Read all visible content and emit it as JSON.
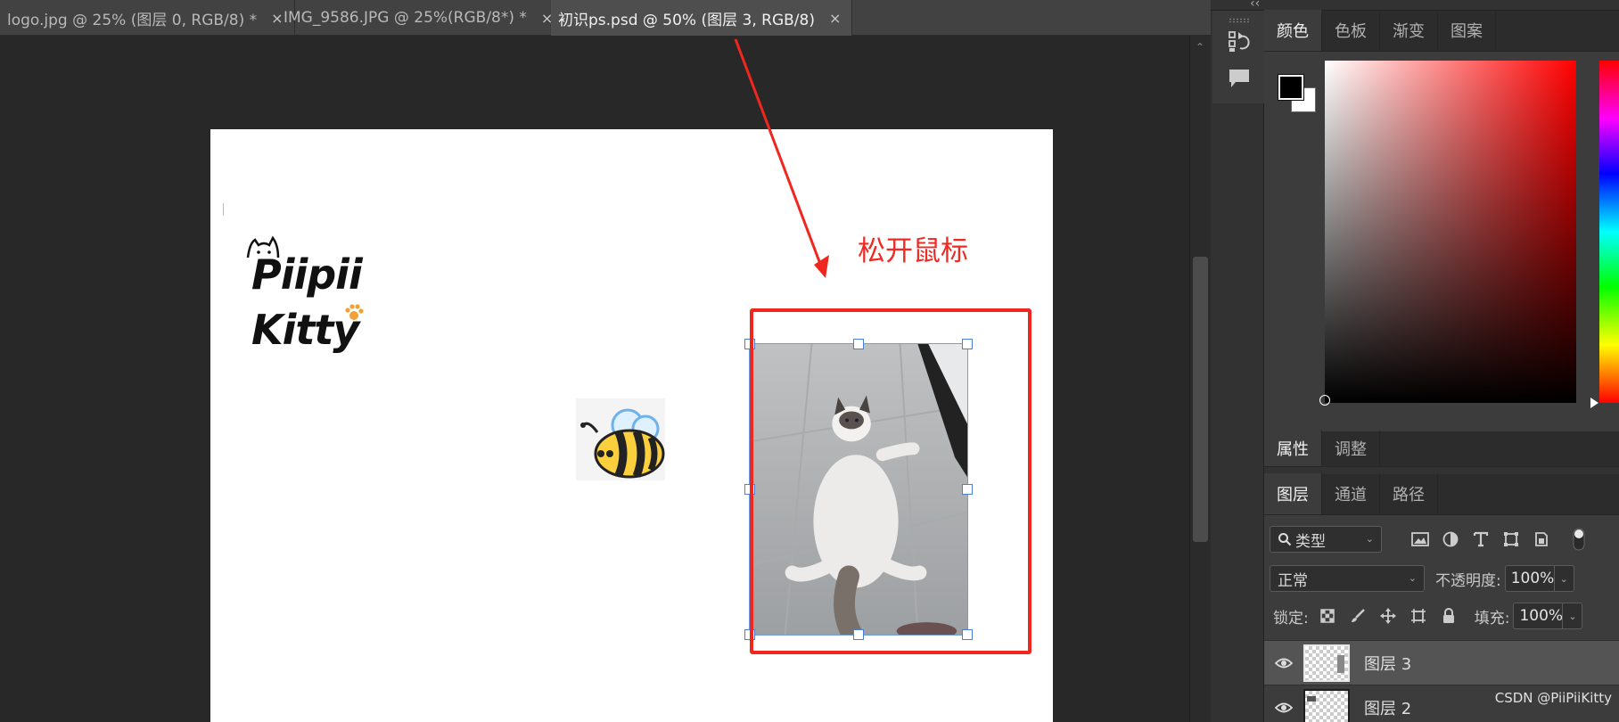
{
  "document_tabs": [
    {
      "title": "logo.jpg @ 25% (图层 0, RGB/8) *",
      "close": "×",
      "active": false
    },
    {
      "title": "IMG_9586.JPG @ 25%(RGB/8*) *",
      "close": "×",
      "active": false
    },
    {
      "title": "初识ps.psd @ 50% (图层 3, RGB/8)",
      "close": "×",
      "active": true
    }
  ],
  "canvas": {
    "logo_line1": "Piipii",
    "logo_line2": "Kitty",
    "annotation": "松开鼠标"
  },
  "dock": {
    "collapse_glyph": "‹‹"
  },
  "color_panel": {
    "tabs": [
      "颜色",
      "色板",
      "渐变",
      "图案"
    ],
    "active_tab": "颜色",
    "foreground_color": "#000000",
    "background_color": "#ffffff"
  },
  "properties_panel": {
    "tabs": [
      "属性",
      "调整"
    ],
    "active_tab": "属性"
  },
  "layers_panel": {
    "tabs": [
      "图层",
      "通道",
      "路径"
    ],
    "active_tab": "图层",
    "filter_label": "类型",
    "blend_mode": "正常",
    "opacity_label": "不透明度:",
    "opacity_value": "100%",
    "lock_label": "锁定:",
    "fill_label": "填充:",
    "fill_value": "100%",
    "layers": [
      {
        "name": "图层 3",
        "visible": true,
        "selected": true
      },
      {
        "name": "图层 2",
        "visible": true,
        "selected": false
      }
    ]
  },
  "watermark": "CSDN @PiiPiiKitty",
  "colors": {
    "annotation_red": "#f0271f",
    "selection_blue": "#4a80d0",
    "panel_bg": "#3c3c3c"
  }
}
